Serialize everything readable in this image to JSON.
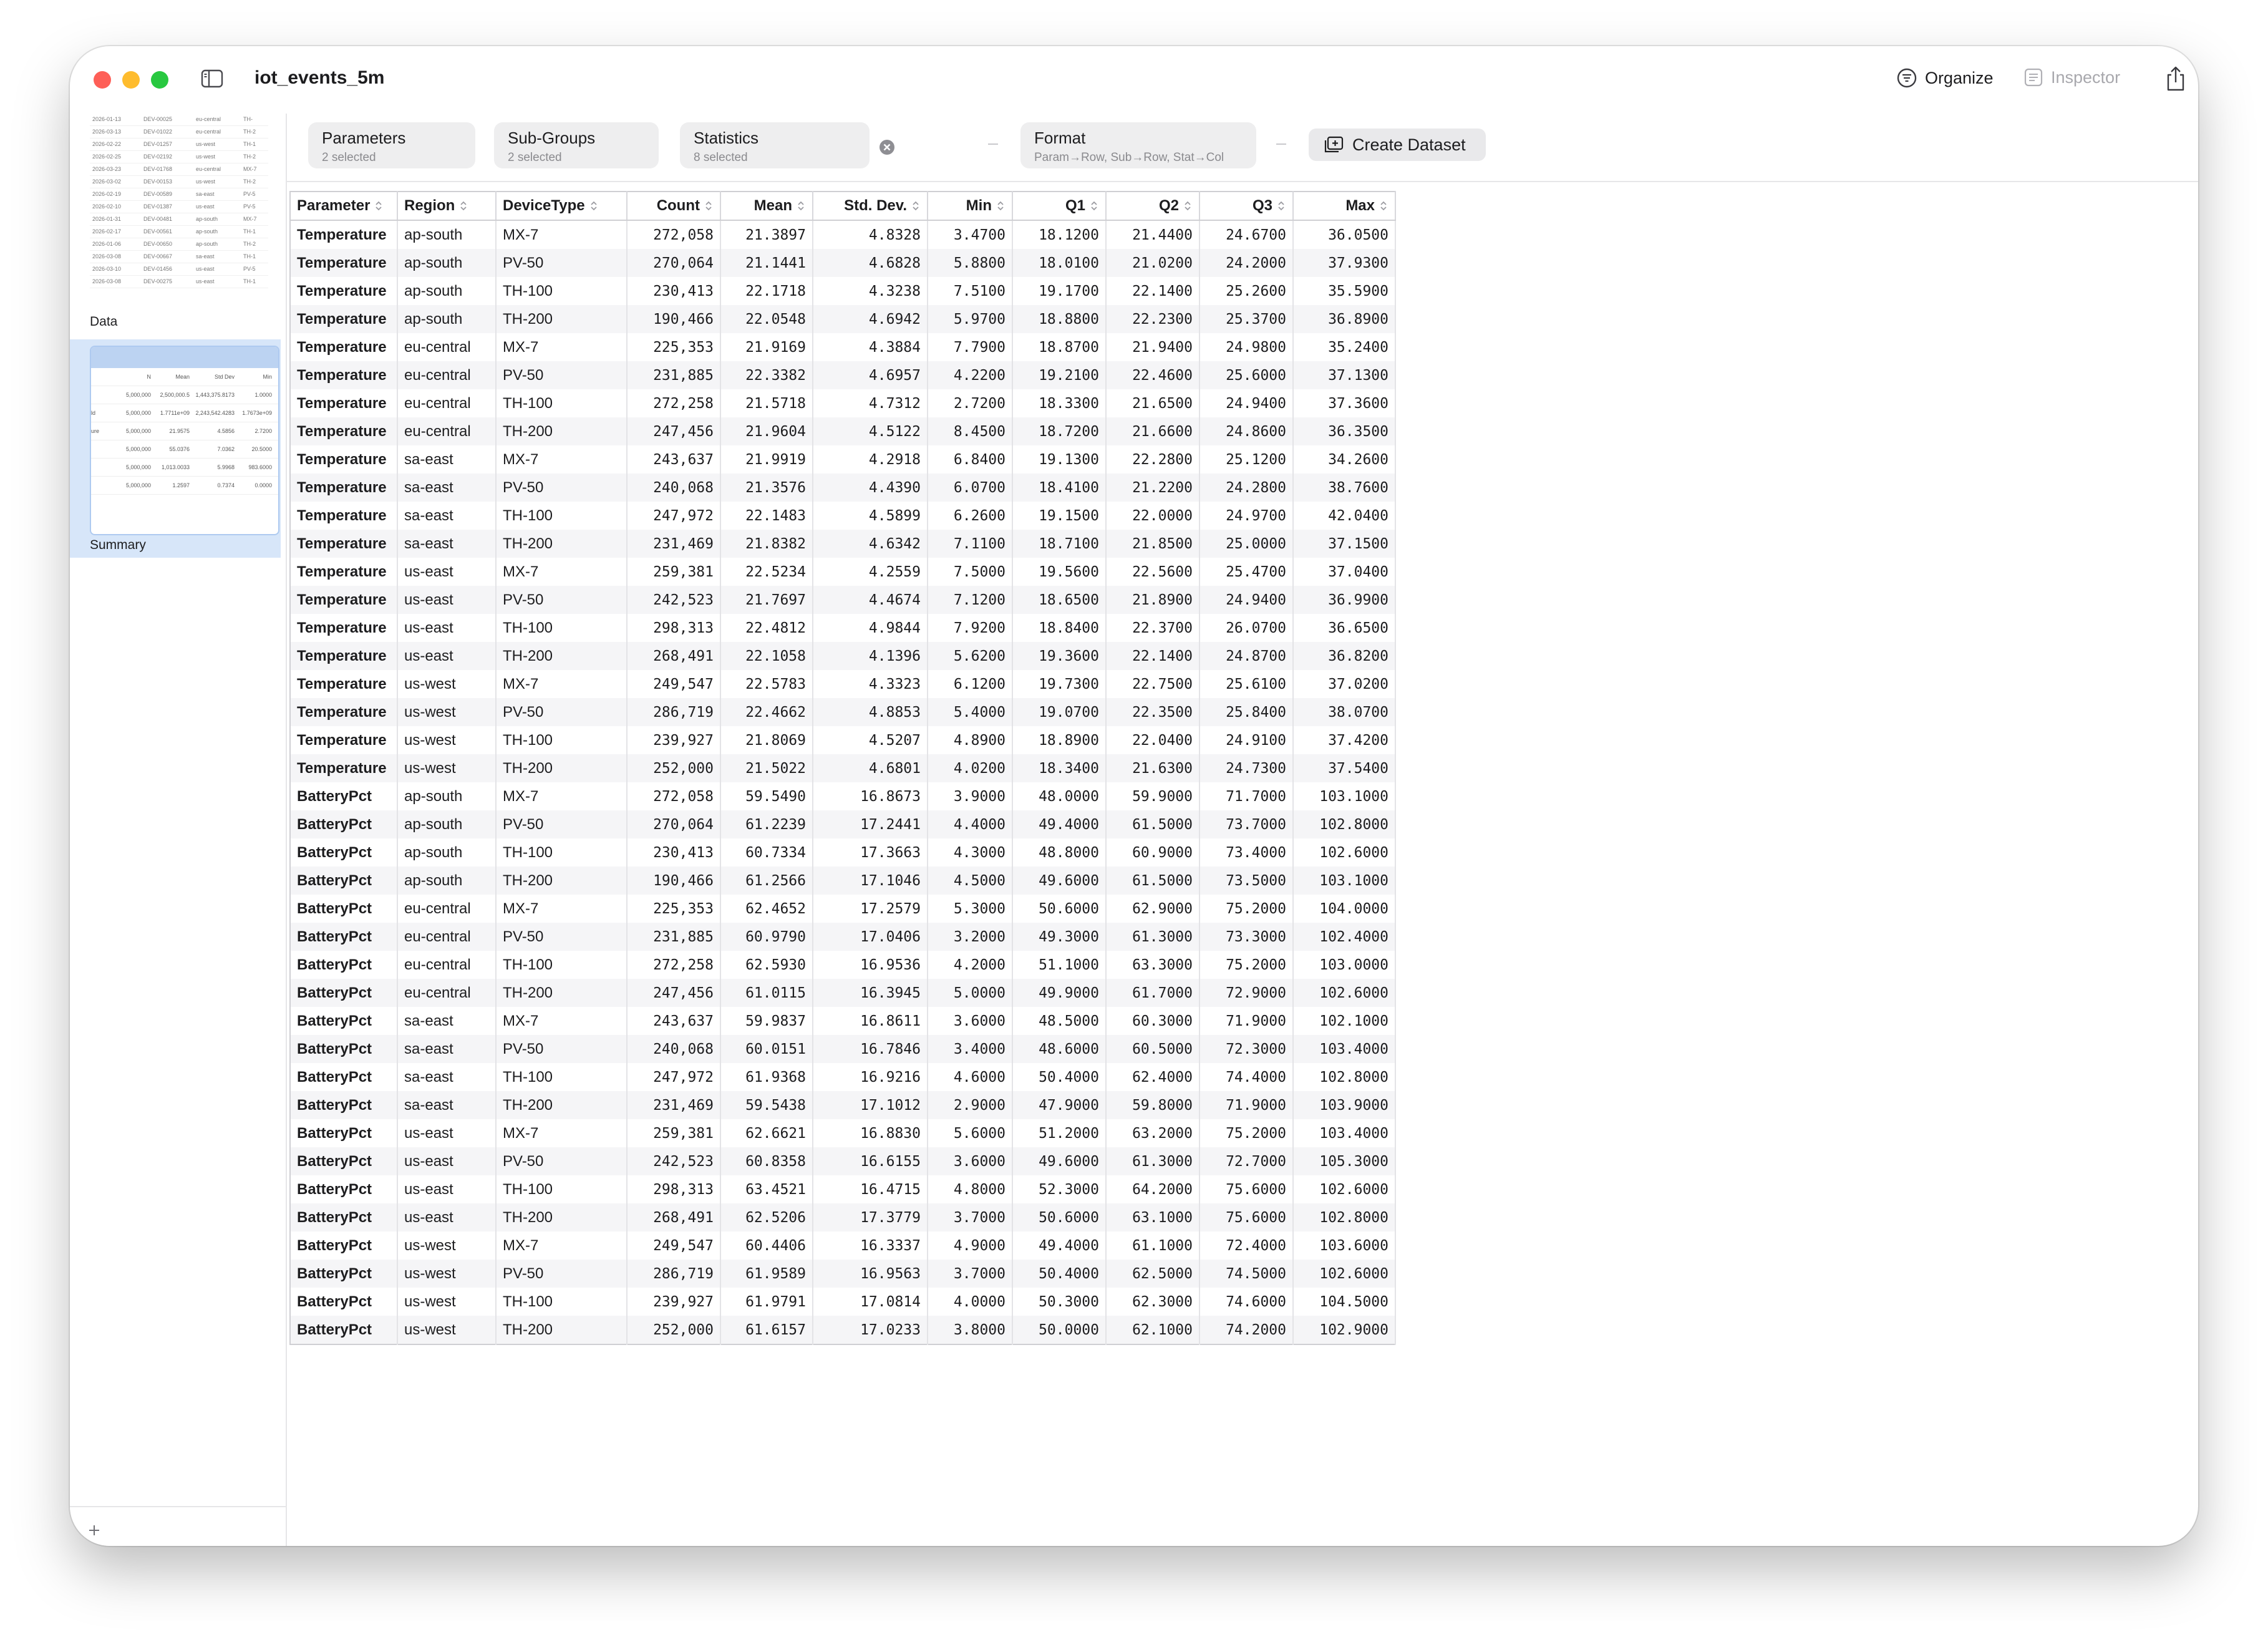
{
  "window": {
    "title": "iot_events_5m"
  },
  "toolbar_right": {
    "organize": "Organize",
    "inspector": "Inspector"
  },
  "sidebar": {
    "items": [
      {
        "label": "Data"
      },
      {
        "label": "Summary"
      }
    ],
    "data_thumb_rows": [
      [
        "2026-01-13",
        "DEV-00025",
        "eu-central",
        "TH-"
      ],
      [
        "2026-03-13",
        "DEV-01022",
        "eu-central",
        "TH-2"
      ],
      [
        "2026-02-22",
        "DEV-01257",
        "us-west",
        "TH-1"
      ],
      [
        "2026-02-25",
        "DEV-02192",
        "us-west",
        "TH-2"
      ],
      [
        "2026-03-23",
        "DEV-01768",
        "eu-central",
        "MX-7"
      ],
      [
        "2026-03-02",
        "DEV-00153",
        "us-west",
        "TH-2"
      ],
      [
        "2026-02-19",
        "DEV-00589",
        "sa-east",
        "PV-5"
      ],
      [
        "2026-02-10",
        "DEV-01387",
        "us-east",
        "PV-5"
      ],
      [
        "2026-01-31",
        "DEV-00481",
        "ap-south",
        "MX-7"
      ],
      [
        "2026-02-17",
        "DEV-00561",
        "ap-south",
        "TH-1"
      ],
      [
        "2026-01-06",
        "DEV-00650",
        "ap-south",
        "TH-2"
      ],
      [
        "2026-03-08",
        "DEV-00667",
        "sa-east",
        "TH-1"
      ],
      [
        "2026-03-10",
        "DEV-01456",
        "us-east",
        "PV-5"
      ],
      [
        "2026-03-08",
        "DEV-00275",
        "us-east",
        "TH-1"
      ]
    ],
    "summary_thumb_header": [
      "N",
      "Mean",
      "Std Dev",
      "Min"
    ],
    "summary_thumb_rows": [
      [
        "",
        "5,000,000",
        "2,500,000.5",
        "1,443,375.8173",
        "1.0000"
      ],
      [
        "ld",
        "5,000,000",
        "1.7711e+09",
        "2,243,542.4283",
        "1.7673e+09"
      ],
      [
        "ure",
        "5,000,000",
        "21.9575",
        "4.5856",
        "2.7200"
      ],
      [
        "",
        "5,000,000",
        "55.0376",
        "7.0362",
        "20.5000"
      ],
      [
        "",
        "5,000,000",
        "1,013.0033",
        "5.9968",
        "983.6000"
      ],
      [
        "",
        "5,000,000",
        "1.2597",
        "0.7374",
        "0.0000"
      ]
    ]
  },
  "controls": {
    "parameters": {
      "title": "Parameters",
      "sub": "2 selected"
    },
    "subgroups": {
      "title": "Sub-Groups",
      "sub": "2 selected"
    },
    "statistics": {
      "title": "Statistics",
      "sub": "8 selected"
    },
    "format": {
      "title": "Format",
      "sub": "Param→Row, Sub→Row, Stat→Col"
    },
    "create_dataset": "Create Dataset"
  },
  "table": {
    "columns": [
      "Parameter",
      "Region",
      "DeviceType",
      "Count",
      "Mean",
      "Std. Dev.",
      "Min",
      "Q1",
      "Q2",
      "Q3",
      "Max"
    ],
    "rows": [
      [
        "Temperature",
        "ap-south",
        "MX-7",
        "272,058",
        "21.3897",
        "4.8328",
        "3.4700",
        "18.1200",
        "21.4400",
        "24.6700",
        "36.0500"
      ],
      [
        "Temperature",
        "ap-south",
        "PV-50",
        "270,064",
        "21.1441",
        "4.6828",
        "5.8800",
        "18.0100",
        "21.0200",
        "24.2000",
        "37.9300"
      ],
      [
        "Temperature",
        "ap-south",
        "TH-100",
        "230,413",
        "22.1718",
        "4.3238",
        "7.5100",
        "19.1700",
        "22.1400",
        "25.2600",
        "35.5900"
      ],
      [
        "Temperature",
        "ap-south",
        "TH-200",
        "190,466",
        "22.0548",
        "4.6942",
        "5.9700",
        "18.8800",
        "22.2300",
        "25.3700",
        "36.8900"
      ],
      [
        "Temperature",
        "eu-central",
        "MX-7",
        "225,353",
        "21.9169",
        "4.3884",
        "7.7900",
        "18.8700",
        "21.9400",
        "24.9800",
        "35.2400"
      ],
      [
        "Temperature",
        "eu-central",
        "PV-50",
        "231,885",
        "22.3382",
        "4.6957",
        "4.2200",
        "19.2100",
        "22.4600",
        "25.6000",
        "37.1300"
      ],
      [
        "Temperature",
        "eu-central",
        "TH-100",
        "272,258",
        "21.5718",
        "4.7312",
        "2.7200",
        "18.3300",
        "21.6500",
        "24.9400",
        "37.3600"
      ],
      [
        "Temperature",
        "eu-central",
        "TH-200",
        "247,456",
        "21.9604",
        "4.5122",
        "8.4500",
        "18.7200",
        "21.6600",
        "24.8600",
        "36.3500"
      ],
      [
        "Temperature",
        "sa-east",
        "MX-7",
        "243,637",
        "21.9919",
        "4.2918",
        "6.8400",
        "19.1300",
        "22.2800",
        "25.1200",
        "34.2600"
      ],
      [
        "Temperature",
        "sa-east",
        "PV-50",
        "240,068",
        "21.3576",
        "4.4390",
        "6.0700",
        "18.4100",
        "21.2200",
        "24.2800",
        "38.7600"
      ],
      [
        "Temperature",
        "sa-east",
        "TH-100",
        "247,972",
        "22.1483",
        "4.5899",
        "6.2600",
        "19.1500",
        "22.0000",
        "24.9700",
        "42.0400"
      ],
      [
        "Temperature",
        "sa-east",
        "TH-200",
        "231,469",
        "21.8382",
        "4.6342",
        "7.1100",
        "18.7100",
        "21.8500",
        "25.0000",
        "37.1500"
      ],
      [
        "Temperature",
        "us-east",
        "MX-7",
        "259,381",
        "22.5234",
        "4.2559",
        "7.5000",
        "19.5600",
        "22.5600",
        "25.4700",
        "37.0400"
      ],
      [
        "Temperature",
        "us-east",
        "PV-50",
        "242,523",
        "21.7697",
        "4.4674",
        "7.1200",
        "18.6500",
        "21.8900",
        "24.9400",
        "36.9900"
      ],
      [
        "Temperature",
        "us-east",
        "TH-100",
        "298,313",
        "22.4812",
        "4.9844",
        "7.9200",
        "18.8400",
        "22.3700",
        "26.0700",
        "36.6500"
      ],
      [
        "Temperature",
        "us-east",
        "TH-200",
        "268,491",
        "22.1058",
        "4.1396",
        "5.6200",
        "19.3600",
        "22.1400",
        "24.8700",
        "36.8200"
      ],
      [
        "Temperature",
        "us-west",
        "MX-7",
        "249,547",
        "22.5783",
        "4.3323",
        "6.1200",
        "19.7300",
        "22.7500",
        "25.6100",
        "37.0200"
      ],
      [
        "Temperature",
        "us-west",
        "PV-50",
        "286,719",
        "22.4662",
        "4.8853",
        "5.4000",
        "19.0700",
        "22.3500",
        "25.8400",
        "38.0700"
      ],
      [
        "Temperature",
        "us-west",
        "TH-100",
        "239,927",
        "21.8069",
        "4.5207",
        "4.8900",
        "18.8900",
        "22.0400",
        "24.9100",
        "37.4200"
      ],
      [
        "Temperature",
        "us-west",
        "TH-200",
        "252,000",
        "21.5022",
        "4.6801",
        "4.0200",
        "18.3400",
        "21.6300",
        "24.7300",
        "37.5400"
      ],
      [
        "BatteryPct",
        "ap-south",
        "MX-7",
        "272,058",
        "59.5490",
        "16.8673",
        "3.9000",
        "48.0000",
        "59.9000",
        "71.7000",
        "103.1000"
      ],
      [
        "BatteryPct",
        "ap-south",
        "PV-50",
        "270,064",
        "61.2239",
        "17.2441",
        "4.4000",
        "49.4000",
        "61.5000",
        "73.7000",
        "102.8000"
      ],
      [
        "BatteryPct",
        "ap-south",
        "TH-100",
        "230,413",
        "60.7334",
        "17.3663",
        "4.3000",
        "48.8000",
        "60.9000",
        "73.4000",
        "102.6000"
      ],
      [
        "BatteryPct",
        "ap-south",
        "TH-200",
        "190,466",
        "61.2566",
        "17.1046",
        "4.5000",
        "49.6000",
        "61.5000",
        "73.5000",
        "103.1000"
      ],
      [
        "BatteryPct",
        "eu-central",
        "MX-7",
        "225,353",
        "62.4652",
        "17.2579",
        "5.3000",
        "50.6000",
        "62.9000",
        "75.2000",
        "104.0000"
      ],
      [
        "BatteryPct",
        "eu-central",
        "PV-50",
        "231,885",
        "60.9790",
        "17.0406",
        "3.2000",
        "49.3000",
        "61.3000",
        "73.3000",
        "102.4000"
      ],
      [
        "BatteryPct",
        "eu-central",
        "TH-100",
        "272,258",
        "62.5930",
        "16.9536",
        "4.2000",
        "51.1000",
        "63.3000",
        "75.2000",
        "103.0000"
      ],
      [
        "BatteryPct",
        "eu-central",
        "TH-200",
        "247,456",
        "61.0115",
        "16.3945",
        "5.0000",
        "49.9000",
        "61.7000",
        "72.9000",
        "102.6000"
      ],
      [
        "BatteryPct",
        "sa-east",
        "MX-7",
        "243,637",
        "59.9837",
        "16.8611",
        "3.6000",
        "48.5000",
        "60.3000",
        "71.9000",
        "102.1000"
      ],
      [
        "BatteryPct",
        "sa-east",
        "PV-50",
        "240,068",
        "60.0151",
        "16.7846",
        "3.4000",
        "48.6000",
        "60.5000",
        "72.3000",
        "103.4000"
      ],
      [
        "BatteryPct",
        "sa-east",
        "TH-100",
        "247,972",
        "61.9368",
        "16.9216",
        "4.6000",
        "50.4000",
        "62.4000",
        "74.4000",
        "102.8000"
      ],
      [
        "BatteryPct",
        "sa-east",
        "TH-200",
        "231,469",
        "59.5438",
        "17.1012",
        "2.9000",
        "47.9000",
        "59.8000",
        "71.9000",
        "103.9000"
      ],
      [
        "BatteryPct",
        "us-east",
        "MX-7",
        "259,381",
        "62.6621",
        "16.8830",
        "5.6000",
        "51.2000",
        "63.2000",
        "75.2000",
        "103.4000"
      ],
      [
        "BatteryPct",
        "us-east",
        "PV-50",
        "242,523",
        "60.8358",
        "16.6155",
        "3.6000",
        "49.6000",
        "61.3000",
        "72.7000",
        "105.3000"
      ],
      [
        "BatteryPct",
        "us-east",
        "TH-100",
        "298,313",
        "63.4521",
        "16.4715",
        "4.8000",
        "52.3000",
        "64.2000",
        "75.6000",
        "102.6000"
      ],
      [
        "BatteryPct",
        "us-east",
        "TH-200",
        "268,491",
        "62.5206",
        "17.3779",
        "3.7000",
        "50.6000",
        "63.1000",
        "75.6000",
        "102.8000"
      ],
      [
        "BatteryPct",
        "us-west",
        "MX-7",
        "249,547",
        "60.4406",
        "16.3337",
        "4.9000",
        "49.4000",
        "61.1000",
        "72.4000",
        "103.6000"
      ],
      [
        "BatteryPct",
        "us-west",
        "PV-50",
        "286,719",
        "61.9589",
        "16.9563",
        "3.7000",
        "50.4000",
        "62.5000",
        "74.5000",
        "102.6000"
      ],
      [
        "BatteryPct",
        "us-west",
        "TH-100",
        "239,927",
        "61.9791",
        "17.0814",
        "4.0000",
        "50.3000",
        "62.3000",
        "74.6000",
        "104.5000"
      ],
      [
        "BatteryPct",
        "us-west",
        "TH-200",
        "252,000",
        "61.6157",
        "17.0233",
        "3.8000",
        "50.0000",
        "62.1000",
        "74.2000",
        "102.9000"
      ]
    ]
  }
}
